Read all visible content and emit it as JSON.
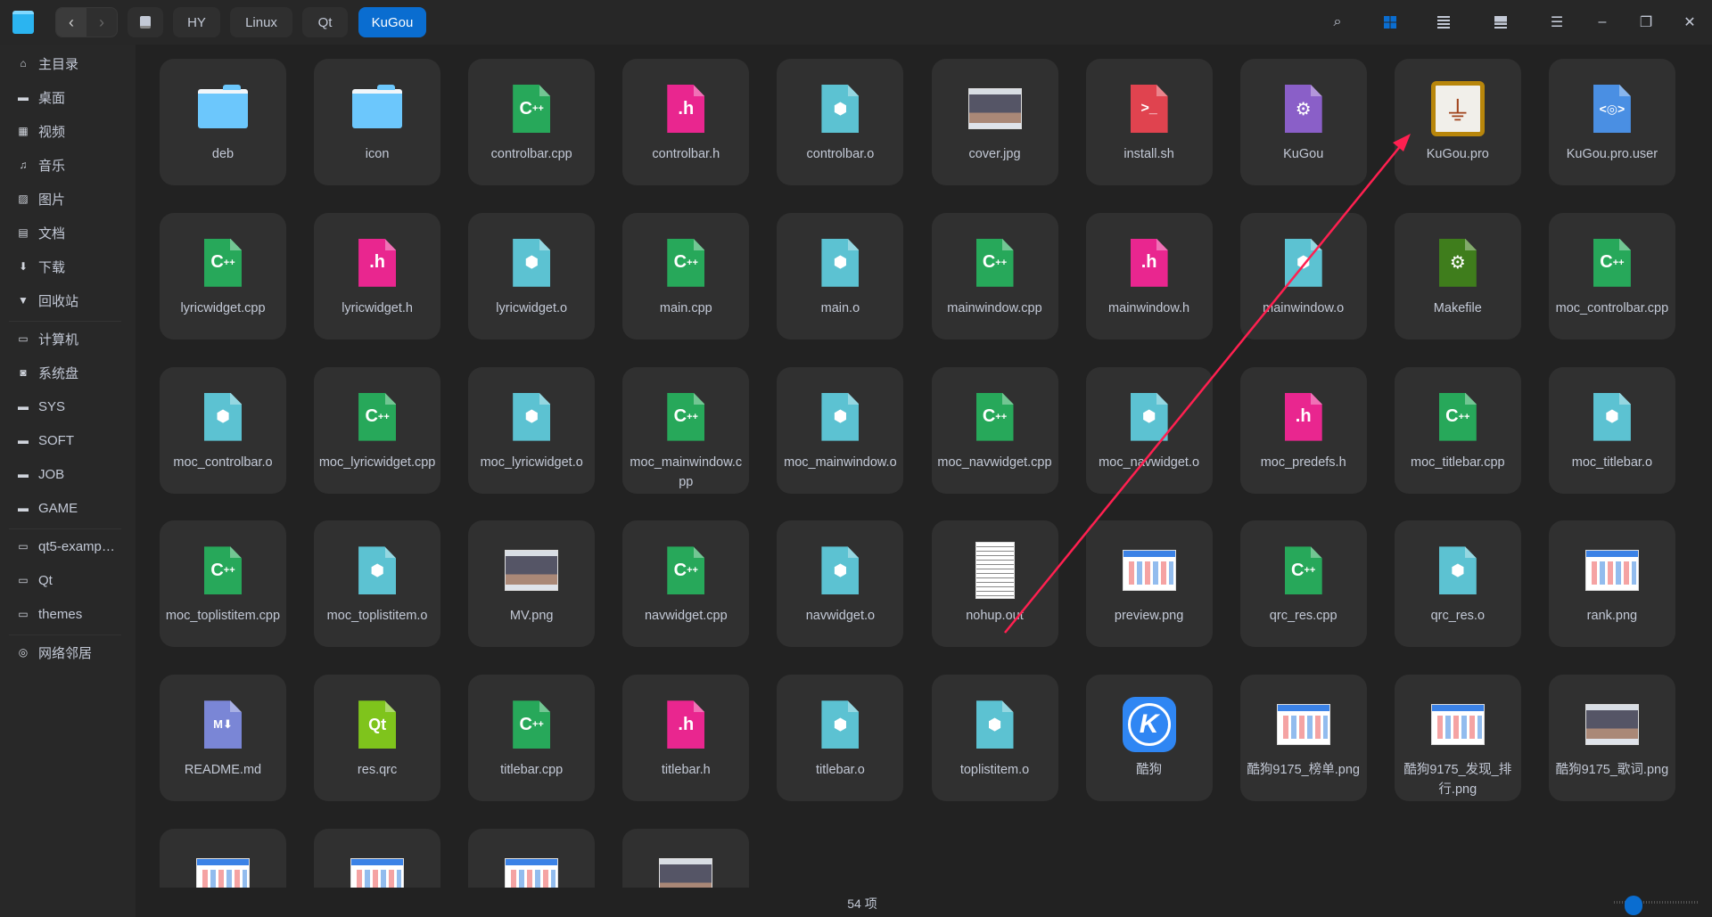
{
  "titlebar": {
    "breadcrumbs": [
      "HY",
      "Linux",
      "Qt",
      "KuGou"
    ],
    "active_breadcrumb": "KuGou",
    "icons": [
      "search-icon",
      "icon-view-icon",
      "list-view-icon",
      "extend-view-icon",
      "menu-icon",
      "minimize-icon",
      "maximize-icon",
      "close-icon"
    ]
  },
  "sidebar": {
    "groups": [
      [
        {
          "label": "主目录",
          "icon": "home-icon"
        },
        {
          "label": "桌面",
          "icon": "desktop-icon"
        },
        {
          "label": "视频",
          "icon": "video-icon"
        },
        {
          "label": "音乐",
          "icon": "music-icon"
        },
        {
          "label": "图片",
          "icon": "picture-icon"
        },
        {
          "label": "文档",
          "icon": "document-icon"
        },
        {
          "label": "下载",
          "icon": "download-icon"
        },
        {
          "label": "回收站",
          "icon": "trash-icon"
        }
      ],
      [
        {
          "label": "计算机",
          "icon": "computer-icon"
        },
        {
          "label": "系统盘",
          "icon": "system-disk-icon"
        },
        {
          "label": "SYS",
          "icon": "disk-icon"
        },
        {
          "label": "SOFT",
          "icon": "disk-icon"
        },
        {
          "label": "JOB",
          "icon": "disk-icon"
        },
        {
          "label": "GAME",
          "icon": "disk-icon"
        }
      ],
      [
        {
          "label": "qt5-examp…",
          "icon": "bookmark-folder-icon"
        },
        {
          "label": "Qt",
          "icon": "bookmark-folder-icon"
        },
        {
          "label": "themes",
          "icon": "bookmark-folder-icon"
        }
      ],
      [
        {
          "label": "网络邻居",
          "icon": "network-icon"
        }
      ]
    ]
  },
  "files": [
    {
      "name": "deb",
      "type": "folder"
    },
    {
      "name": "icon",
      "type": "folder"
    },
    {
      "name": "controlbar.cpp",
      "type": "cpp"
    },
    {
      "name": "controlbar.h",
      "type": "h"
    },
    {
      "name": "controlbar.o",
      "type": "o"
    },
    {
      "name": "cover.jpg",
      "type": "img-dark"
    },
    {
      "name": "install.sh",
      "type": "sh"
    },
    {
      "name": "KuGou",
      "type": "exec"
    },
    {
      "name": "KuGou.pro",
      "type": "pro"
    },
    {
      "name": "KuGou.pro.user",
      "type": "user"
    },
    {
      "name": "lyricwidget.cpp",
      "type": "cpp"
    },
    {
      "name": "lyricwidget.h",
      "type": "h"
    },
    {
      "name": "lyricwidget.o",
      "type": "o"
    },
    {
      "name": "main.cpp",
      "type": "cpp"
    },
    {
      "name": "main.o",
      "type": "o"
    },
    {
      "name": "mainwindow.cpp",
      "type": "cpp"
    },
    {
      "name": "mainwindow.h",
      "type": "h"
    },
    {
      "name": "mainwindow.o",
      "type": "o"
    },
    {
      "name": "Makefile",
      "type": "make"
    },
    {
      "name": "moc_controlbar.cpp",
      "type": "cpp"
    },
    {
      "name": "moc_controlbar.o",
      "type": "o"
    },
    {
      "name": "moc_lyricwidget.cpp",
      "type": "cpp"
    },
    {
      "name": "moc_lyricwidget.o",
      "type": "o"
    },
    {
      "name": "moc_mainwindow.cpp",
      "type": "cpp"
    },
    {
      "name": "moc_mainwindow.o",
      "type": "o"
    },
    {
      "name": "moc_navwidget.cpp",
      "type": "cpp"
    },
    {
      "name": "moc_navwidget.o",
      "type": "o"
    },
    {
      "name": "moc_predefs.h",
      "type": "h"
    },
    {
      "name": "moc_titlebar.cpp",
      "type": "cpp"
    },
    {
      "name": "moc_titlebar.o",
      "type": "o"
    },
    {
      "name": "moc_toplistitem.cpp",
      "type": "cpp"
    },
    {
      "name": "moc_toplistitem.o",
      "type": "o"
    },
    {
      "name": "MV.png",
      "type": "img-dark"
    },
    {
      "name": "navwidget.cpp",
      "type": "cpp"
    },
    {
      "name": "navwidget.o",
      "type": "o"
    },
    {
      "name": "nohup.out",
      "type": "text"
    },
    {
      "name": "preview.png",
      "type": "img-web"
    },
    {
      "name": "qrc_res.cpp",
      "type": "cpp"
    },
    {
      "name": "qrc_res.o",
      "type": "o"
    },
    {
      "name": "rank.png",
      "type": "img-web"
    },
    {
      "name": "README.md",
      "type": "md"
    },
    {
      "name": "res.qrc",
      "type": "qrc"
    },
    {
      "name": "titlebar.cpp",
      "type": "cpp"
    },
    {
      "name": "titlebar.h",
      "type": "h"
    },
    {
      "name": "titlebar.o",
      "type": "o"
    },
    {
      "name": "toplistitem.o",
      "type": "o"
    },
    {
      "name": "酷狗",
      "type": "app"
    },
    {
      "name": "酷狗9175_榜单.png",
      "type": "img-web"
    },
    {
      "name": "酷狗9175_发现_排行.png",
      "type": "img-web"
    },
    {
      "name": "酷狗9175_歌词.png",
      "type": "img-dark"
    },
    {
      "name": "",
      "type": "img-web"
    },
    {
      "name": "",
      "type": "img-web"
    },
    {
      "name": "",
      "type": "img-web"
    },
    {
      "name": "",
      "type": "img-dark"
    }
  ],
  "status": {
    "count": "54 项",
    "icon_size_level": 0.15
  },
  "colors": {
    "accent": "#0a6dd0",
    "cpp": "#27a85a",
    "h": "#e9268f",
    "o": "#5cc2d2",
    "sh": "#e0434f",
    "exec": "#8a5fc8",
    "user": "#4a8fe3",
    "make": "#3f7d1c",
    "md": "#7a86d6",
    "qrc": "#7fc41c",
    "annotation": "#ff2050"
  }
}
